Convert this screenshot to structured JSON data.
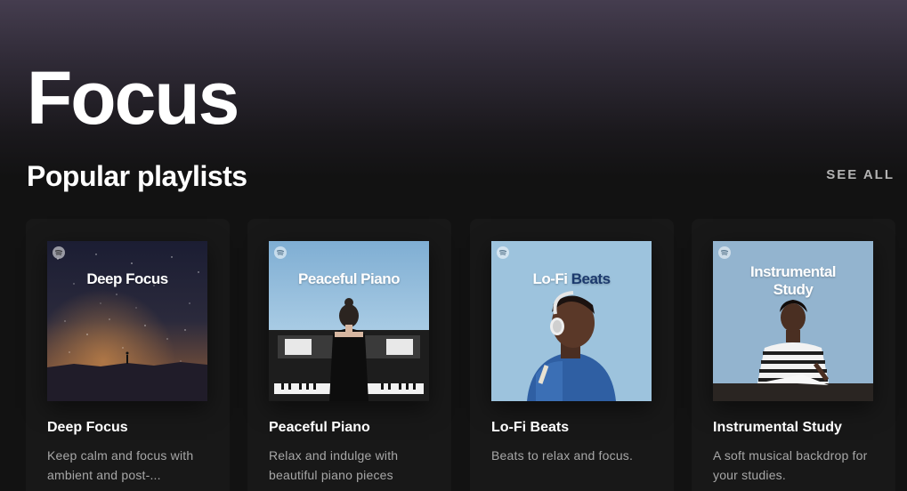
{
  "header": {
    "title": "Focus"
  },
  "section": {
    "title": "Popular playlists",
    "see_all_label": "SEE ALL"
  },
  "playlists": [
    {
      "cover_title": "Deep Focus",
      "name": "Deep Focus",
      "description": "Keep calm and focus with ambient and post-..."
    },
    {
      "cover_title": "Peaceful Piano",
      "name": "Peaceful Piano",
      "description": "Relax and indulge with beautiful piano pieces"
    },
    {
      "cover_title_part1": "Lo-Fi",
      "cover_title_part2": "Beats",
      "name": "Lo-Fi Beats",
      "description": "Beats to relax and focus."
    },
    {
      "cover_title_line1": "Instrumental",
      "cover_title_line2": "Study",
      "name": "Instrumental Study",
      "description": "A soft musical backdrop for your studies."
    }
  ],
  "colors": {
    "background": "#121212",
    "card": "#181818",
    "muted_text": "#a7a7a7",
    "header_gradient_top": "#453d4f",
    "lofi_accent": "#1c3a6e"
  },
  "icons": {
    "cover_badge": "spotify-logo-icon"
  }
}
